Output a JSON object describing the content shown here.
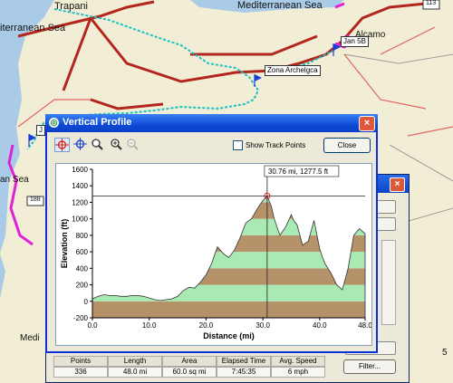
{
  "map": {
    "labels": [
      "Trapani",
      "Mediterranean Sea",
      "iterranean Sea",
      "Alcamo",
      "an Sea",
      "Medi"
    ],
    "route_markers": [
      "113",
      "188"
    ],
    "waypoints": [
      "Jan 5B",
      "Zona Archelgca",
      "J"
    ],
    "side_label": "5"
  },
  "dialog": {
    "title": "Vertical Profile",
    "close_title": "×",
    "show_track_points": "Show Track Points",
    "close_button": "Close",
    "tools": [
      "crosshair-red-icon",
      "crosshair-blue-icon",
      "zoom-icon",
      "zoom-in-icon",
      "zoom-out-icon"
    ]
  },
  "track_window": {
    "filter_button": "Filter...",
    "stats_headers": [
      "Points",
      "Length",
      "Area",
      "Elapsed Time",
      "Avg. Speed"
    ],
    "stats_values": [
      "336",
      "48.0 mi",
      "60.0 sq mi",
      "7:45:35",
      "6 mph"
    ]
  },
  "chart_data": {
    "type": "area",
    "xlabel": "Distance   (mi)",
    "ylabel": "Elevation  (ft)",
    "xlim": [
      0,
      48
    ],
    "ylim": [
      -200,
      1600
    ],
    "x_ticks": [
      "0.0",
      "10.0",
      "20.0",
      "30.0",
      "40.0",
      "48.0"
    ],
    "y_ticks": [
      "1600",
      "1400",
      "1200",
      "1000",
      "800",
      "600",
      "400",
      "200",
      "0",
      "-200"
    ],
    "annotation": "30.76 mi, 1277.5 ft",
    "cursor": {
      "x": 30.76,
      "y": 1277.5
    },
    "band_colors": [
      "#a8e9b4",
      "#b5926a"
    ],
    "series": [
      {
        "x": [
          0,
          1,
          2,
          3,
          4,
          5,
          6,
          7,
          8,
          9,
          10,
          11,
          12,
          13,
          14,
          15,
          16,
          17,
          18,
          19,
          20,
          21,
          22,
          23,
          24,
          25,
          26,
          27,
          28,
          29,
          30,
          30.76,
          31.5,
          32,
          33,
          34,
          35,
          35.5,
          36,
          37,
          38,
          39,
          40,
          40.5,
          41,
          42,
          43,
          44,
          45,
          46,
          47,
          48
        ],
        "y": [
          30,
          60,
          80,
          70,
          70,
          60,
          60,
          70,
          70,
          60,
          40,
          20,
          10,
          20,
          30,
          60,
          130,
          170,
          160,
          230,
          320,
          460,
          660,
          580,
          530,
          620,
          770,
          950,
          1000,
          1120,
          1220,
          1277.5,
          1150,
          1000,
          800,
          900,
          1050,
          970,
          930,
          680,
          730,
          980,
          640,
          530,
          450,
          340,
          200,
          140,
          400,
          800,
          880,
          820
        ]
      }
    ]
  }
}
